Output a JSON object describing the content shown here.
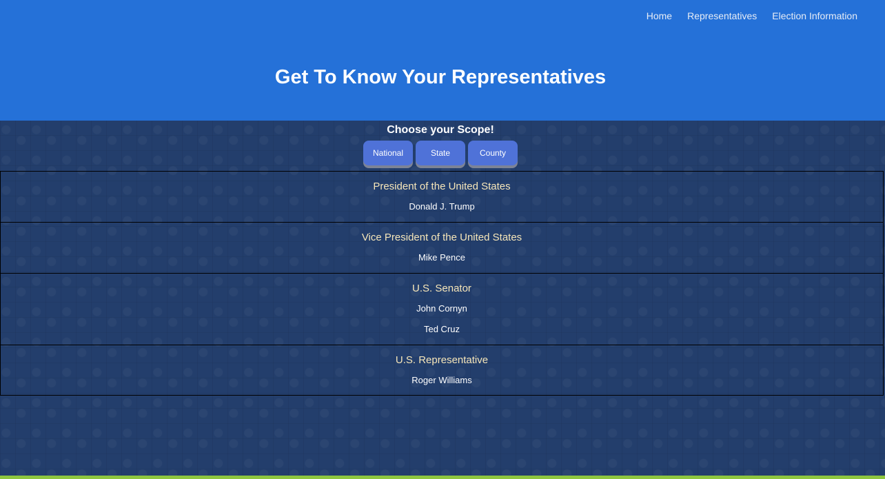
{
  "nav": {
    "items": [
      {
        "label": "Home"
      },
      {
        "label": "Representatives"
      },
      {
        "label": "Election Information"
      }
    ]
  },
  "header": {
    "title": "Get To Know Your Representatives"
  },
  "scope": {
    "heading": "Choose your Scope!",
    "buttons": [
      {
        "label": "National"
      },
      {
        "label": "State"
      },
      {
        "label": "County"
      }
    ]
  },
  "offices": [
    {
      "title": "President of the United States",
      "officials": [
        "Donald J. Trump"
      ]
    },
    {
      "title": "Vice President of the United States",
      "officials": [
        "Mike Pence"
      ]
    },
    {
      "title": "U.S. Senator",
      "officials": [
        "John Cornyn",
        "Ted Cruz"
      ]
    },
    {
      "title": "U.S. Representative",
      "officials": [
        "Roger Williams"
      ]
    }
  ],
  "colors": {
    "header_bg": "#2571d8",
    "page_bg": "#233e6c",
    "button_bg": "#4f72d8",
    "office_title": "#f6e6b9",
    "footer_accent": "#8ec63f"
  }
}
